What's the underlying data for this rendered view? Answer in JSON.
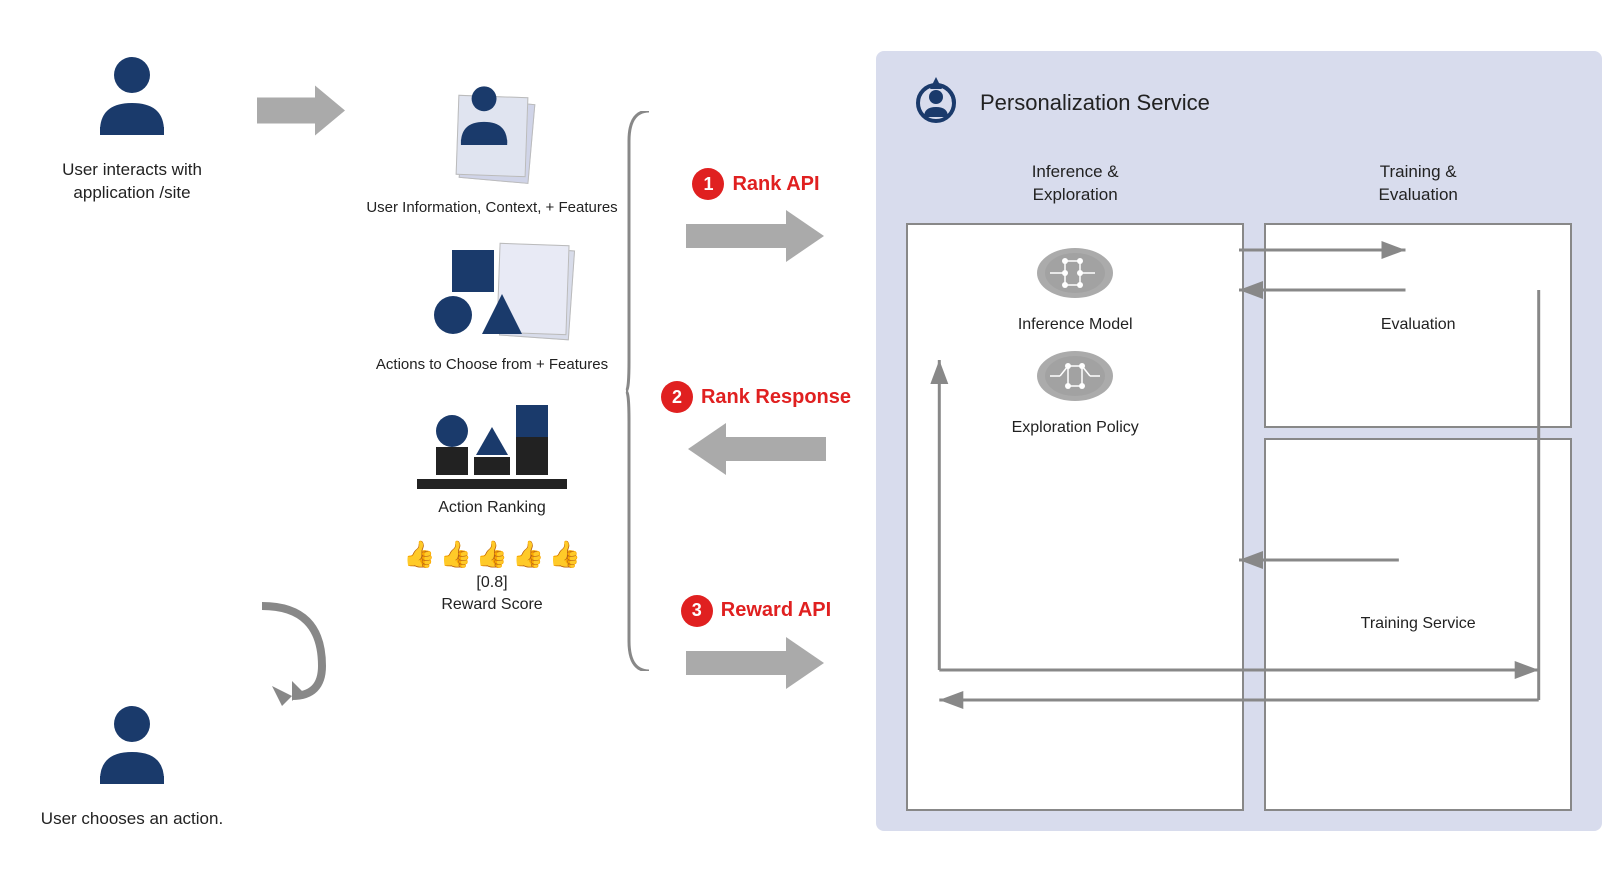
{
  "left": {
    "user_top_label": "User interacts with application /site",
    "user_bottom_label": "User chooses an action.",
    "arrow_right_alt": "arrow right"
  },
  "features": {
    "user_info_label": "User Information, Context,  + Features",
    "actions_label": "Actions to Choose from + Features",
    "action_ranking_label": "Action Ranking",
    "reward_score_label": "Reward Score",
    "reward_value": "[0.8]"
  },
  "apis": {
    "rank_api_number": "1",
    "rank_api_label": "Rank API",
    "rank_response_number": "2",
    "rank_response_label": "Rank Response",
    "reward_api_number": "3",
    "reward_api_label": "Reward API"
  },
  "personalization": {
    "title": "Personalization Service",
    "inference_title": "Inference &\nExploration",
    "training_title": "Training &\nEvaluation",
    "inference_model_label": "Inference Model",
    "exploration_policy_label": "Exploration Policy",
    "evaluation_label": "Evaluation",
    "training_service_label": "Training Service"
  }
}
